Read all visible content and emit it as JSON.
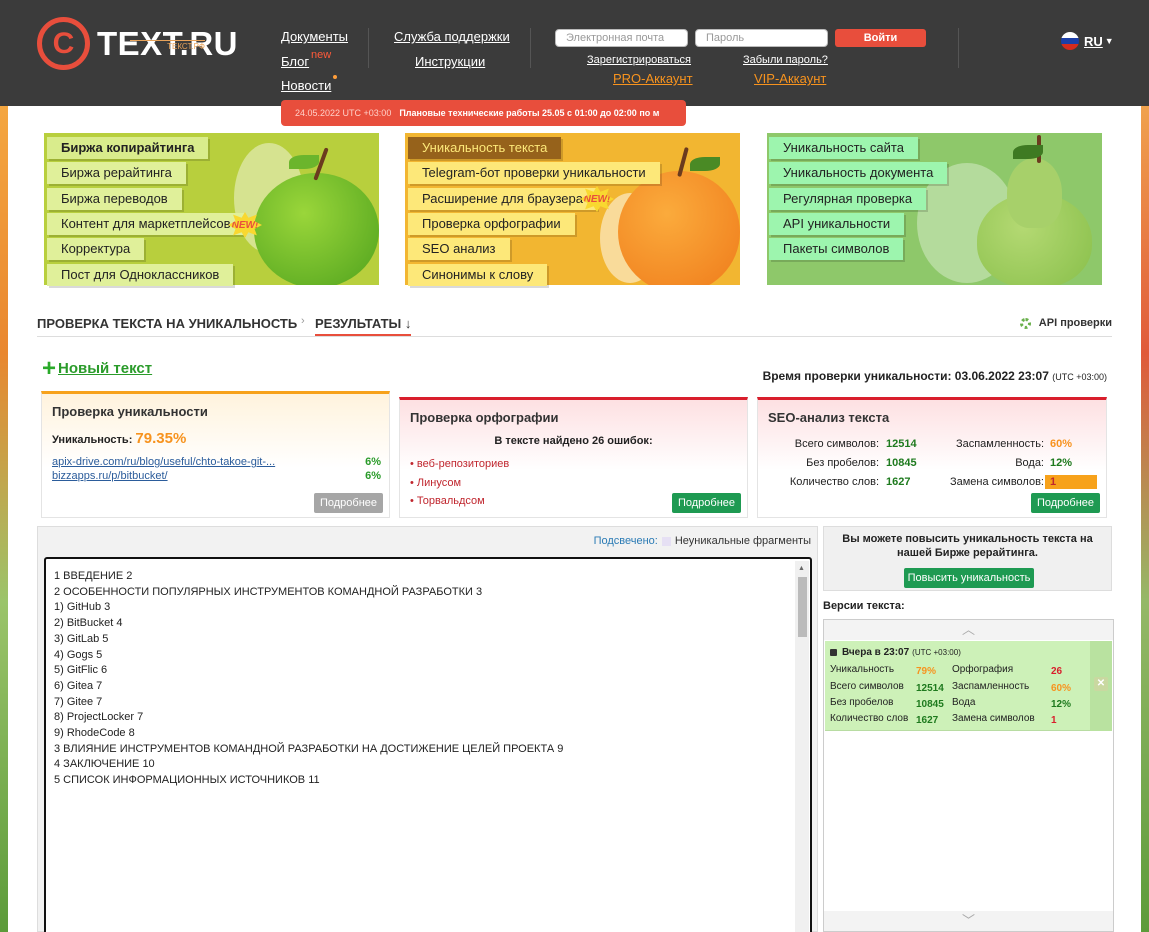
{
  "header": {
    "logo_letter": "C",
    "logo_text": "TEXT.RU",
    "logo_sub": "ТЕКСТ.РФ",
    "nav": {
      "documents": "Документы",
      "blog": "Блог",
      "blog_badge": "new",
      "news": "Новости",
      "support": "Служба поддержки",
      "instructions": "Инструкции"
    },
    "login": {
      "email_placeholder": "Электронная почта",
      "password_placeholder": "Пароль",
      "login_button": "Войти",
      "register": "Зарегистрироваться",
      "forgot": "Забыли пароль?",
      "pro": "PRO-Аккаунт",
      "vip": "VIP-Аккаунт"
    },
    "language": "RU",
    "notice": {
      "time": "24.05.2022 UTC +03:00",
      "message": "Плановые технические работы 25.05 с 01:00 до 02:00 по м"
    }
  },
  "banners": {
    "green": [
      "Биржа копирайтинга",
      "Биржа рерайтинга",
      "Биржа переводов",
      "Контент для маркетплейсов",
      "Корректура",
      "Пост для Одноклассников"
    ],
    "orange": [
      "Уникальность текста",
      "Telegram-бот проверки уникальности",
      "Расширение для браузера",
      "Проверка орфографии",
      "SEO анализ",
      "Синонимы к слову"
    ],
    "pear": [
      "Уникальность сайта",
      "Уникальность документа",
      "Регулярная проверка",
      "API уникальности",
      "Пакеты символов"
    ],
    "new_label": "NEW!"
  },
  "breadcrumbs": {
    "first": "ПРОВЕРКА ТЕКСТА НА УНИКАЛЬНОСТЬ",
    "second": "РЕЗУЛЬТАТЫ",
    "arrow": "↓",
    "api": "API проверки"
  },
  "new_text": "Новый текст",
  "check_time": {
    "label": "Время проверки уникальности: 03.06.2022 23:07",
    "tz": "(UTC +03:00)"
  },
  "uniqueness": {
    "title": "Проверка уникальности",
    "label": "Уникальность:",
    "value": "79.35%",
    "sources": [
      {
        "url": "apix-drive.com/ru/blog/useful/chto-takoe-git-...",
        "percent": "6%"
      },
      {
        "url": "bizzapps.ru/p/bitbucket/",
        "percent": "6%"
      }
    ],
    "more": "Подробнее"
  },
  "spelling": {
    "title": "Проверка орфографии",
    "summary": "В тексте найдено 26 ошибок:",
    "errors": [
      "веб-репозиториев",
      "Линусом",
      "Торвальдсом"
    ],
    "more": "Подробнее"
  },
  "seo": {
    "title": "SEO-анализ текста",
    "total_chars_label": "Всего символов:",
    "total_chars": "12514",
    "no_spaces_label": "Без пробелов:",
    "no_spaces": "10845",
    "words_label": "Количество слов:",
    "words": "1627",
    "spam_label": "Заспамленность:",
    "spam": "60%",
    "water_label": "Вода:",
    "water": "12%",
    "replaced_label": "Замена символов:",
    "replaced": "1",
    "more": "Подробнее"
  },
  "editor": {
    "highlighted_label": "Подсвечено:",
    "highlight_legend": "Неуникальные фрагменты",
    "lines": [
      "1 ВВЕДЕНИЕ 2",
      "2 ОСОБЕННОСТИ ПОПУЛЯРНЫХ ИНСТРУМЕНТОВ КОМАНДНОЙ РАЗРАБОТКИ 3",
      "1) GitHub 3",
      "2) BitBucket 4",
      "3) GitLab 5",
      "4) Gogs 5",
      "5) GitFlic 6",
      "6) Gitea 7",
      "7) Gitee 7",
      "8) ProjectLocker 7",
      "9) RhodeCode 8",
      "3 ВЛИЯНИЕ ИНСТРУМЕНТОВ КОМАНДНОЙ РАЗРАБОТКИ НА ДОСТИЖЕНИЕ ЦЕЛЕЙ ПРОЕКТА 9",
      "4 ЗАКЛЮЧЕНИЕ 10",
      "5 СПИСОК ИНФОРМАЦИОННЫХ ИСТОЧНИКОВ 11"
    ]
  },
  "promo": {
    "text": "Вы можете повысить уникальность текста на нашей Бирже рерайтинга.",
    "button": "Повысить уникальность"
  },
  "versions": {
    "title": "Версии текста:",
    "item": {
      "time": "Вчера в 23:07",
      "tz": "(UTC +03:00)",
      "uniq_label": "Уникальность",
      "uniq": "79%",
      "total_label": "Всего символов",
      "total": "12514",
      "nospace_label": "Без пробелов",
      "nospace": "10845",
      "words_label": "Количество слов",
      "words": "1627",
      "spell_label": "Орфография",
      "spell": "26",
      "spam_label": "Заспамленность",
      "spam": "60%",
      "water_label": "Вода",
      "water": "12%",
      "replaced_label": "Замена символов",
      "replaced": "1"
    }
  },
  "colors": {
    "brand_red": "#e84e3c",
    "accent_orange": "#f7931e",
    "success_green": "#1e9a52"
  }
}
